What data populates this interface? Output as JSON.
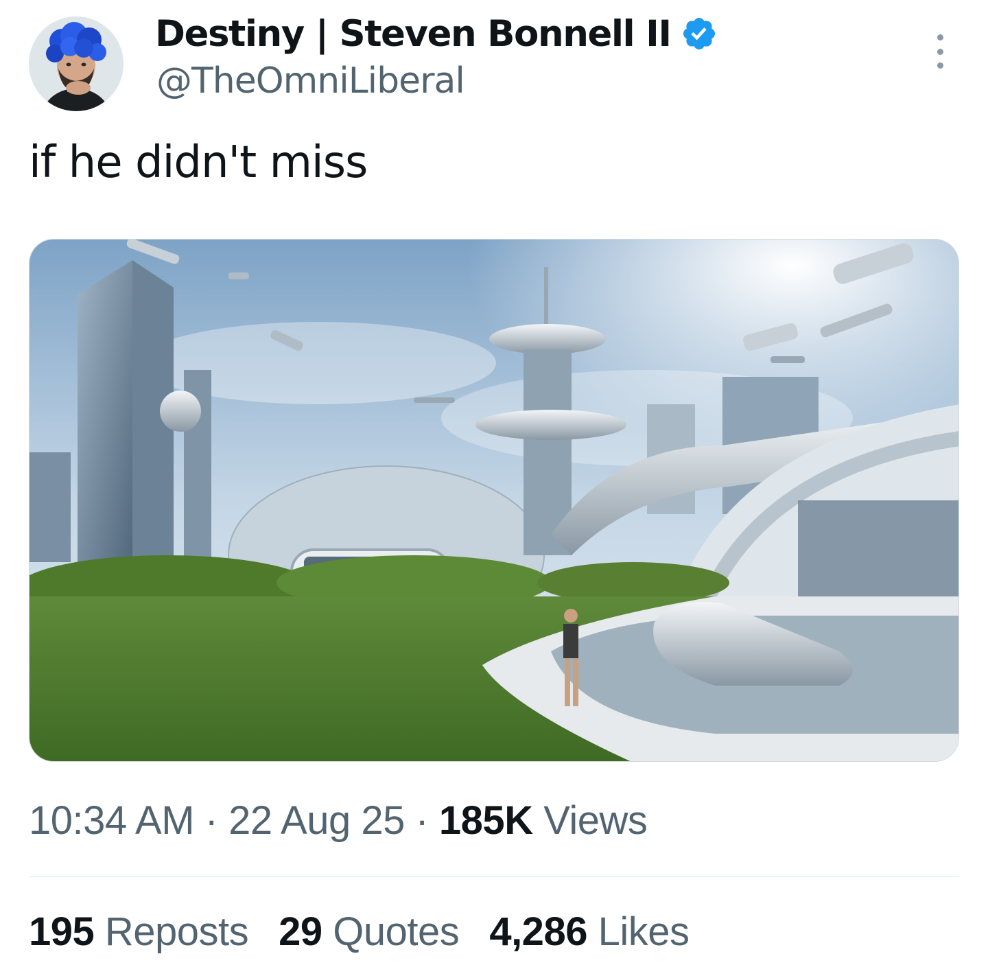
{
  "author": {
    "display_name": "Destiny | Steven Bonnell II",
    "handle": "@TheOmniLiberal",
    "verified": true,
    "verified_color": "#1d9bf0",
    "avatar_icon": "profile-avatar-blue-hair"
  },
  "more_icon": "more-options-icon",
  "tweet": {
    "text": "if he didn't miss",
    "media_icon": "futuristic-city-image"
  },
  "meta": {
    "time": "10:34 AM",
    "separator": " · ",
    "date": "22 Aug 25",
    "views_count": "185K",
    "views_label": " Views"
  },
  "stats": {
    "reposts_count": "195",
    "reposts_label": " Reposts",
    "quotes_count": "29",
    "quotes_label": " Quotes",
    "likes_count": "4,286",
    "likes_label": " Likes"
  },
  "colors": {
    "text_primary": "#0f1419",
    "text_secondary": "#536471",
    "divider": "#eff3f4"
  }
}
